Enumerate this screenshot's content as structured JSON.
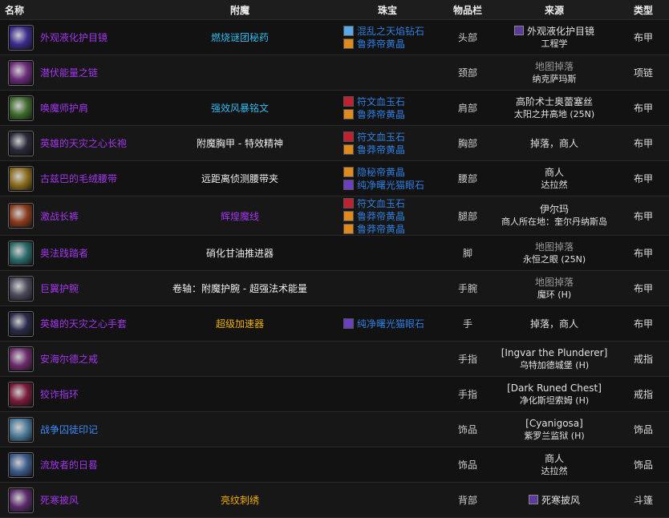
{
  "headers": {
    "name": "名称",
    "enchant": "附魔",
    "gems": "珠宝",
    "slot": "物品栏",
    "source": "来源",
    "type": "类型"
  },
  "rows": [
    {
      "name": "外观液化护目镜",
      "name_color": "purple",
      "icon_color": "#3b2b8f",
      "enchant": "燃烧谜团秘药",
      "enchant_color": "#33bbee",
      "gems": [
        {
          "text": "混乱之天焰钻石",
          "color": "#5aa9e6"
        },
        {
          "text": "鲁莽帝黄晶",
          "color": "#e08a1e"
        }
      ],
      "slot": "头部",
      "src1": "外观液化护目镜",
      "src2": "工程学",
      "src_icon": true,
      "type": "布甲"
    },
    {
      "name": "潜伏能量之链",
      "name_color": "purple",
      "icon_color": "#6b2a7a",
      "enchant": "",
      "gems": [],
      "slot": "颈部",
      "src1": "地图掉落",
      "src2": "纳克萨玛斯",
      "src1_dim": true,
      "type": "项链"
    },
    {
      "name": "唤魔师护肩",
      "name_color": "purple",
      "icon_color": "#3d6a2a",
      "enchant": "强效风暴铭文",
      "enchant_color": "#33bbee",
      "gems": [
        {
          "text": "符文血玉石",
          "color": "#c02030"
        },
        {
          "text": "鲁莽帝黄晶",
          "color": "#e08a1e"
        }
      ],
      "slot": "肩部",
      "src1": "高阶术士奥蕾塞丝",
      "src2": "太阳之井高地 (25N)",
      "type": "布甲"
    },
    {
      "name": "英雄的天灾之心长袍",
      "name_color": "purple",
      "icon_color": "#2a2a3a",
      "enchant": "附魔胸甲 - 特效精神",
      "enchant_color": "#eeeeee",
      "gems": [
        {
          "text": "符文血玉石",
          "color": "#c02030"
        },
        {
          "text": "鲁莽帝黄晶",
          "color": "#e08a1e"
        }
      ],
      "slot": "胸部",
      "src1": "掉落，商人",
      "src2": "",
      "type": "布甲"
    },
    {
      "name": "古兹巴的毛绒腰带",
      "name_color": "purple",
      "icon_color": "#8a6a1a",
      "enchant": "远距离侦测腰带夹",
      "enchant_color": "#eeeeee",
      "gems": [
        {
          "text": "隐秘帝黄晶",
          "color": "#e08a1e"
        },
        {
          "text": "纯净曙光猫眼石",
          "color": "#6a40c0"
        }
      ],
      "slot": "腰部",
      "src1": "商人",
      "src2": "达拉然",
      "type": "布甲"
    },
    {
      "name": "激战长裤",
      "name_color": "purple",
      "icon_color": "#8a3a1a",
      "enchant": "辉煌魔线",
      "enchant_color": "#a335ee",
      "gems": [
        {
          "text": "符文血玉石",
          "color": "#c02030"
        },
        {
          "text": "鲁莽帝黄晶",
          "color": "#e08a1e"
        },
        {
          "text": "鲁莽帝黄晶",
          "color": "#e08a1e"
        }
      ],
      "slot": "腿部",
      "src1": "伊尔玛",
      "src2": "商人所在地：奎尔丹纳斯岛",
      "type": "布甲"
    },
    {
      "name": "奥法践踏者",
      "name_color": "purple",
      "icon_color": "#2a6a6a",
      "enchant": "硝化甘油推进器",
      "enchant_color": "#eeeeee",
      "gems": [],
      "slot": "脚",
      "src1": "地图掉落",
      "src2": "永恒之眼 (25N)",
      "src1_dim": true,
      "type": "布甲"
    },
    {
      "name": "巨翼护腕",
      "name_color": "purple",
      "icon_color": "#4a4a5a",
      "enchant": "卷轴：附魔护腕 - 超强法术能量",
      "enchant_color": "#eeeeee",
      "gems": [],
      "slot": "手腕",
      "src1": "地图掉落",
      "src2": "魔环 (H)",
      "src1_dim": true,
      "type": "布甲"
    },
    {
      "name": "英雄的天灾之心手套",
      "name_color": "purple",
      "icon_color": "#2a2a4a",
      "enchant": "超级加速器",
      "enchant_color": "#f0b000",
      "gems": [
        {
          "text": "纯净曙光猫眼石",
          "color": "#6a40c0"
        }
      ],
      "slot": "手",
      "src1": "掉落，商人",
      "src2": "",
      "type": "布甲"
    },
    {
      "name": "安海尔德之戒",
      "name_color": "purple",
      "icon_color": "#6a2a6a",
      "enchant": "",
      "gems": [],
      "slot": "手指",
      "src1": "[Ingvar the Plunderer]",
      "src2": "乌特加德城堡 (H)",
      "type": "戒指"
    },
    {
      "name": "狡诈指环",
      "name_color": "purple",
      "icon_color": "#7a1a3a",
      "enchant": "",
      "gems": [],
      "slot": "手指",
      "src1": "[Dark Runed Chest]",
      "src2": "净化斯坦索姆 (H)",
      "type": "戒指"
    },
    {
      "name": "战争囚徒印记",
      "name_color": "blue",
      "icon_color": "#4a7a9a",
      "enchant": "",
      "gems": [],
      "slot": "饰品",
      "src1": "[Cyanigosa]",
      "src2": "紫罗兰监狱 (H)",
      "type": "饰品"
    },
    {
      "name": "流放者的日晷",
      "name_color": "purple",
      "icon_color": "#3a5a8a",
      "enchant": "",
      "gems": [],
      "slot": "饰品",
      "src1": "商人",
      "src2": "达拉然",
      "type": "饰品"
    },
    {
      "name": "死寒披风",
      "name_color": "purple",
      "icon_color": "#5a2a6a",
      "enchant": "亮纹刺绣",
      "enchant_color": "#f0b000",
      "gems": [],
      "slot": "背部",
      "src1": "死寒披风",
      "src2": "",
      "src_icon": true,
      "type": "斗篷"
    }
  ]
}
